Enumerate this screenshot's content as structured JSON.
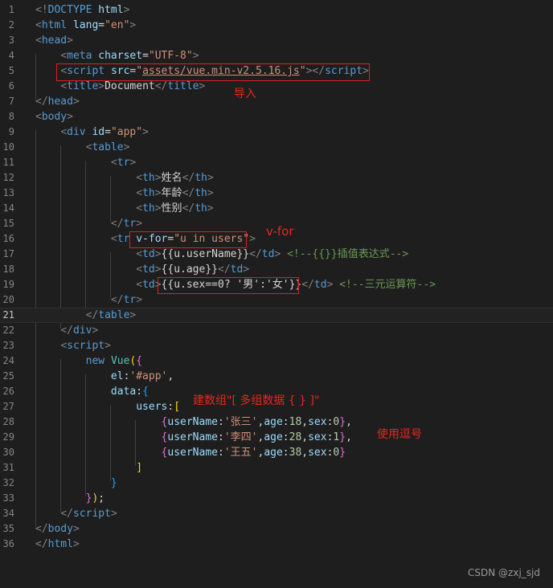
{
  "lines": [
    {
      "n": "1",
      "t": [
        [
          "br",
          "<!"
        ],
        [
          "tag",
          "DOCTYPE"
        ],
        [
          "txt",
          " "
        ],
        [
          "attr",
          "html"
        ],
        [
          "br",
          ">"
        ]
      ]
    },
    {
      "n": "2",
      "t": [
        [
          "br",
          "<"
        ],
        [
          "tag",
          "html"
        ],
        [
          "txt",
          " "
        ],
        [
          "attr",
          "lang"
        ],
        [
          "txt",
          "="
        ],
        [
          "str",
          "\"en\""
        ],
        [
          "br",
          ">"
        ]
      ]
    },
    {
      "n": "3",
      "t": [
        [
          "br",
          "<"
        ],
        [
          "tag",
          "head"
        ],
        [
          "br",
          ">"
        ]
      ]
    },
    {
      "n": "4",
      "t": [
        [
          "txt",
          "    "
        ],
        [
          "br",
          "<"
        ],
        [
          "tag",
          "meta"
        ],
        [
          "txt",
          " "
        ],
        [
          "attr",
          "charset"
        ],
        [
          "txt",
          "="
        ],
        [
          "str",
          "\"UTF-8\""
        ],
        [
          "br",
          ">"
        ]
      ]
    },
    {
      "n": "5",
      "t": [
        [
          "txt",
          "    "
        ],
        [
          "br",
          "<"
        ],
        [
          "tag",
          "script"
        ],
        [
          "txt",
          " "
        ],
        [
          "attr",
          "src"
        ],
        [
          "txt",
          "="
        ],
        [
          "str",
          "\""
        ],
        [
          "stru",
          "assets/vue.min-v2.5.16.js"
        ],
        [
          "str",
          "\""
        ],
        [
          "br",
          "></"
        ],
        [
          "tag",
          "script"
        ],
        [
          "br",
          ">"
        ]
      ]
    },
    {
      "n": "6",
      "t": [
        [
          "txt",
          "    "
        ],
        [
          "br",
          "<"
        ],
        [
          "tag",
          "title"
        ],
        [
          "br",
          ">"
        ],
        [
          "txt",
          "Document"
        ],
        [
          "br",
          "</"
        ],
        [
          "tag",
          "title"
        ],
        [
          "br",
          ">"
        ]
      ]
    },
    {
      "n": "7",
      "t": [
        [
          "br",
          "</"
        ],
        [
          "tag",
          "head"
        ],
        [
          "br",
          ">"
        ]
      ]
    },
    {
      "n": "8",
      "t": [
        [
          "br",
          "<"
        ],
        [
          "tag",
          "body"
        ],
        [
          "br",
          ">"
        ]
      ]
    },
    {
      "n": "9",
      "t": [
        [
          "txt",
          "    "
        ],
        [
          "br",
          "<"
        ],
        [
          "tag",
          "div"
        ],
        [
          "txt",
          " "
        ],
        [
          "attr",
          "id"
        ],
        [
          "txt",
          "="
        ],
        [
          "str",
          "\"app\""
        ],
        [
          "br",
          ">"
        ]
      ]
    },
    {
      "n": "10",
      "t": [
        [
          "txt",
          "        "
        ],
        [
          "br",
          "<"
        ],
        [
          "tag",
          "table"
        ],
        [
          "br",
          ">"
        ]
      ]
    },
    {
      "n": "11",
      "t": [
        [
          "txt",
          "            "
        ],
        [
          "br",
          "<"
        ],
        [
          "tag",
          "tr"
        ],
        [
          "br",
          ">"
        ]
      ]
    },
    {
      "n": "12",
      "t": [
        [
          "txt",
          "                "
        ],
        [
          "br",
          "<"
        ],
        [
          "tag",
          "th"
        ],
        [
          "br",
          ">"
        ],
        [
          "txt",
          "姓名"
        ],
        [
          "br",
          "</"
        ],
        [
          "tag",
          "th"
        ],
        [
          "br",
          ">"
        ]
      ]
    },
    {
      "n": "13",
      "t": [
        [
          "txt",
          "                "
        ],
        [
          "br",
          "<"
        ],
        [
          "tag",
          "th"
        ],
        [
          "br",
          ">"
        ],
        [
          "txt",
          "年龄"
        ],
        [
          "br",
          "</"
        ],
        [
          "tag",
          "th"
        ],
        [
          "br",
          ">"
        ]
      ]
    },
    {
      "n": "14",
      "t": [
        [
          "txt",
          "                "
        ],
        [
          "br",
          "<"
        ],
        [
          "tag",
          "th"
        ],
        [
          "br",
          ">"
        ],
        [
          "txt",
          "性别"
        ],
        [
          "br",
          "</"
        ],
        [
          "tag",
          "th"
        ],
        [
          "br",
          ">"
        ]
      ]
    },
    {
      "n": "15",
      "t": [
        [
          "txt",
          "            "
        ],
        [
          "br",
          "</"
        ],
        [
          "tag",
          "tr"
        ],
        [
          "br",
          ">"
        ]
      ]
    },
    {
      "n": "16",
      "t": [
        [
          "txt",
          "            "
        ],
        [
          "br",
          "<"
        ],
        [
          "tag",
          "tr"
        ],
        [
          "txt",
          " "
        ],
        [
          "attr",
          "v-for"
        ],
        [
          "txt",
          "="
        ],
        [
          "str",
          "\"u in users\""
        ],
        [
          "br",
          ">"
        ]
      ]
    },
    {
      "n": "17",
      "t": [
        [
          "txt",
          "                "
        ],
        [
          "br",
          "<"
        ],
        [
          "tag",
          "td"
        ],
        [
          "br",
          ">"
        ],
        [
          "txt",
          "{{u.userName}}"
        ],
        [
          "br",
          "</"
        ],
        [
          "tag",
          "td"
        ],
        [
          "br",
          ">"
        ],
        [
          "txt",
          " "
        ],
        [
          "com",
          "<!--{{}}插值表达式-->"
        ]
      ]
    },
    {
      "n": "18",
      "t": [
        [
          "txt",
          "                "
        ],
        [
          "br",
          "<"
        ],
        [
          "tag",
          "td"
        ],
        [
          "br",
          ">"
        ],
        [
          "txt",
          "{{u.age}}"
        ],
        [
          "br",
          "</"
        ],
        [
          "tag",
          "td"
        ],
        [
          "br",
          ">"
        ]
      ]
    },
    {
      "n": "19",
      "t": [
        [
          "txt",
          "                "
        ],
        [
          "br",
          "<"
        ],
        [
          "tag",
          "td"
        ],
        [
          "br",
          ">"
        ],
        [
          "txt",
          "{{u.sex==0? '男':'女'}}"
        ],
        [
          "br",
          "</"
        ],
        [
          "tag",
          "td"
        ],
        [
          "br",
          ">"
        ],
        [
          "txt",
          " "
        ],
        [
          "com",
          "<!--三元运算符-->"
        ]
      ]
    },
    {
      "n": "20",
      "t": [
        [
          "txt",
          "            "
        ],
        [
          "br",
          "</"
        ],
        [
          "tag",
          "tr"
        ],
        [
          "br",
          ">"
        ]
      ]
    },
    {
      "n": "21",
      "t": [
        [
          "txt",
          "        "
        ],
        [
          "br",
          "</"
        ],
        [
          "tag",
          "table"
        ],
        [
          "br",
          ">"
        ]
      ],
      "active": true
    },
    {
      "n": "22",
      "t": [
        [
          "txt",
          "    "
        ],
        [
          "br",
          "</"
        ],
        [
          "tag",
          "div"
        ],
        [
          "br",
          ">"
        ]
      ]
    },
    {
      "n": "23",
      "t": [
        [
          "txt",
          "    "
        ],
        [
          "br",
          "<"
        ],
        [
          "tag",
          "script"
        ],
        [
          "br",
          ">"
        ]
      ]
    },
    {
      "n": "24",
      "t": [
        [
          "txt",
          "        "
        ],
        [
          "kw",
          "new"
        ],
        [
          "txt",
          " "
        ],
        [
          "cls",
          "Vue"
        ],
        [
          "p1",
          "("
        ],
        [
          "p2",
          "{"
        ]
      ]
    },
    {
      "n": "25",
      "t": [
        [
          "txt",
          "            "
        ],
        [
          "prop",
          "el"
        ],
        [
          "txt",
          ":"
        ],
        [
          "str",
          "'#app'"
        ],
        [
          "txt",
          ","
        ]
      ]
    },
    {
      "n": "26",
      "t": [
        [
          "txt",
          "            "
        ],
        [
          "prop",
          "data"
        ],
        [
          "txt",
          ":"
        ],
        [
          "p3",
          "{"
        ]
      ]
    },
    {
      "n": "27",
      "t": [
        [
          "txt",
          "                "
        ],
        [
          "prop",
          "users"
        ],
        [
          "txt",
          ":"
        ],
        [
          "p1",
          "["
        ]
      ]
    },
    {
      "n": "28",
      "t": [
        [
          "txt",
          "                    "
        ],
        [
          "p2",
          "{"
        ],
        [
          "prop",
          "userName"
        ],
        [
          "txt",
          ":"
        ],
        [
          "str",
          "'张三'"
        ],
        [
          "txt",
          ","
        ],
        [
          "prop",
          "age"
        ],
        [
          "txt",
          ":"
        ],
        [
          "num",
          "18"
        ],
        [
          "txt",
          ","
        ],
        [
          "prop",
          "sex"
        ],
        [
          "txt",
          ":"
        ],
        [
          "num",
          "0"
        ],
        [
          "p2",
          "}"
        ],
        [
          "txt",
          ","
        ]
      ]
    },
    {
      "n": "29",
      "t": [
        [
          "txt",
          "                    "
        ],
        [
          "p2",
          "{"
        ],
        [
          "prop",
          "userName"
        ],
        [
          "txt",
          ":"
        ],
        [
          "str",
          "'李四'"
        ],
        [
          "txt",
          ","
        ],
        [
          "prop",
          "age"
        ],
        [
          "txt",
          ":"
        ],
        [
          "num",
          "28"
        ],
        [
          "txt",
          ","
        ],
        [
          "prop",
          "sex"
        ],
        [
          "txt",
          ":"
        ],
        [
          "num",
          "1"
        ],
        [
          "p2",
          "}"
        ],
        [
          "txt",
          ","
        ]
      ]
    },
    {
      "n": "30",
      "t": [
        [
          "txt",
          "                    "
        ],
        [
          "p2",
          "{"
        ],
        [
          "prop",
          "userName"
        ],
        [
          "txt",
          ":"
        ],
        [
          "str",
          "'王五'"
        ],
        [
          "txt",
          ","
        ],
        [
          "prop",
          "age"
        ],
        [
          "txt",
          ":"
        ],
        [
          "num",
          "38"
        ],
        [
          "txt",
          ","
        ],
        [
          "prop",
          "sex"
        ],
        [
          "txt",
          ":"
        ],
        [
          "num",
          "0"
        ],
        [
          "p2",
          "}"
        ]
      ]
    },
    {
      "n": "31",
      "t": [
        [
          "txt",
          "                "
        ],
        [
          "p1",
          "]"
        ]
      ]
    },
    {
      "n": "32",
      "t": [
        [
          "txt",
          "            "
        ],
        [
          "p3",
          "}"
        ]
      ]
    },
    {
      "n": "33",
      "t": [
        [
          "txt",
          "        "
        ],
        [
          "p2",
          "}"
        ],
        [
          "p1",
          ")"
        ],
        [
          "txt",
          ";"
        ]
      ]
    },
    {
      "n": "34",
      "t": [
        [
          "txt",
          "    "
        ],
        [
          "br",
          "</"
        ],
        [
          "tag",
          "script"
        ],
        [
          "br",
          ">"
        ]
      ]
    },
    {
      "n": "35",
      "t": [
        [
          "br",
          "</"
        ],
        [
          "tag",
          "body"
        ],
        [
          "br",
          ">"
        ]
      ]
    },
    {
      "n": "36",
      "t": [
        [
          "br",
          "</"
        ],
        [
          "tag",
          "html"
        ],
        [
          "br",
          ">"
        ]
      ]
    }
  ],
  "annotations": {
    "import": "导入",
    "vfor": "v-for",
    "build_array": "建数组\"[ 多组数据 { } ]\"",
    "use_comma": "使用逗号"
  },
  "watermark": "CSDN @zxj_sjd",
  "colors": {
    "background": "#1e1e1e",
    "annotation_red": "#e8261f",
    "tag_blue": "#569cd6",
    "string_orange": "#ce9178",
    "comment_green": "#6a9955"
  }
}
